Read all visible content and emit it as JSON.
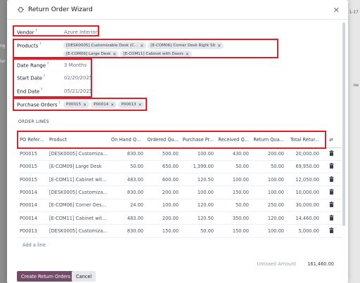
{
  "background": {
    "left_text": [
      "ng",
      "lor"
    ],
    "right_text": [
      "1-17",
      "ne"
    ]
  },
  "modal": {
    "title": "Return Order Wizard",
    "close_icon": "close-icon"
  },
  "form": {
    "vendor": {
      "label": "Vendor",
      "value": "Azure Interior"
    },
    "products": {
      "label": "Products",
      "tags": [
        "[DESK0005] Customizable Desk (C...",
        "[E-COM06] Corner Desk Right Sit",
        "[E-COM09] Large Desk",
        "[E-COM11] Cabinet with Doors"
      ]
    },
    "date_range": {
      "label": "Date Range",
      "value": "3 Months"
    },
    "start_date": {
      "label": "Start Date",
      "value": "02/20/2025"
    },
    "end_date": {
      "label": "End Date",
      "value": "05/21/2025"
    },
    "purchase_orders": {
      "label": "Purchase Orders",
      "tags": [
        "P00015",
        "P00014",
        "P00013"
      ]
    }
  },
  "order_lines": {
    "section_title": "ORDER LINES",
    "columns": [
      "PO Refer...",
      "Product",
      "On Hand Qu...",
      "Ordered Qu...",
      "Purchase Pr...",
      "Received Q...",
      "Return Qua...",
      "Total Retur..."
    ],
    "rows": [
      [
        "P00015",
        "[DESK0005] Customizabl...",
        "830.00",
        "500.00",
        "100.00",
        "430.00",
        "200.00",
        "20,000.00"
      ],
      [
        "P00015",
        "[E-COM09] Large Desk",
        "50.00",
        "650.00",
        "1,399.00",
        "50.00",
        "50.00",
        "69,950.00"
      ],
      [
        "P00015",
        "[E-COM11] Cabinet with ...",
        "483.00",
        "600.00",
        "120.50",
        "100.00",
        "100.00",
        "12,050.00"
      ],
      [
        "P00014",
        "[DESK0005] Customizabl...",
        "830.00",
        "200.00",
        "100.00",
        "150.00",
        "100.00",
        "10,000.00"
      ],
      [
        "P00014",
        "[E-COM06] Corner Desk R...",
        "24.00",
        "100.00",
        "120.00",
        "50.00",
        "250.00",
        "30,000.00"
      ],
      [
        "P00014",
        "[E-COM11] Cabinet with ...",
        "483.00",
        "200.00",
        "120.50",
        "350.00",
        "120.00",
        "14,460.00"
      ],
      [
        "P00013",
        "[DESK0005] Customizabl...",
        "830.00",
        "150.00",
        "50.00",
        "150.00",
        "100.00",
        "5,000.00"
      ]
    ],
    "add_line": "Add a line",
    "untaxed_label": "Untaxed Amount",
    "untaxed_value": "161,460.00"
  },
  "footer": {
    "create_label": "Create Return Orders",
    "cancel_label": "Cancel"
  },
  "colors": {
    "primary": "#714b67",
    "highlight": "#e11d2a"
  }
}
